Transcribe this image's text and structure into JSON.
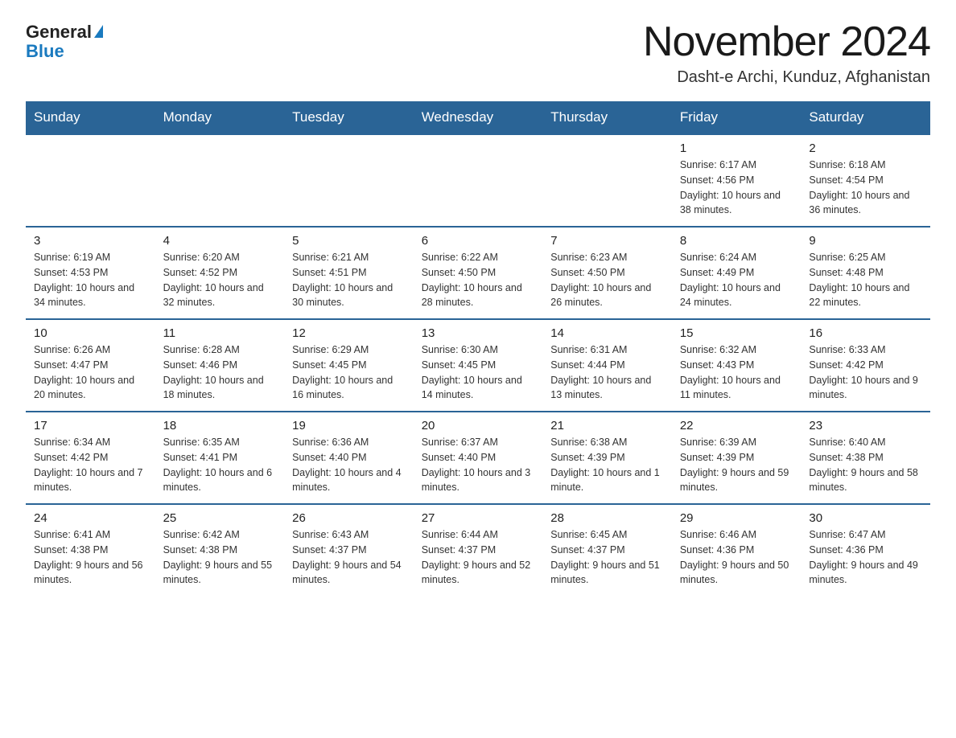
{
  "logo": {
    "general": "General",
    "blue": "Blue",
    "triangle": "▶"
  },
  "title": "November 2024",
  "subtitle": "Dasht-e Archi, Kunduz, Afghanistan",
  "header_color": "#2a6496",
  "weekdays": [
    "Sunday",
    "Monday",
    "Tuesday",
    "Wednesday",
    "Thursday",
    "Friday",
    "Saturday"
  ],
  "weeks": [
    [
      {
        "day": "",
        "info": ""
      },
      {
        "day": "",
        "info": ""
      },
      {
        "day": "",
        "info": ""
      },
      {
        "day": "",
        "info": ""
      },
      {
        "day": "",
        "info": ""
      },
      {
        "day": "1",
        "info": "Sunrise: 6:17 AM\nSunset: 4:56 PM\nDaylight: 10 hours and 38 minutes."
      },
      {
        "day": "2",
        "info": "Sunrise: 6:18 AM\nSunset: 4:54 PM\nDaylight: 10 hours and 36 minutes."
      }
    ],
    [
      {
        "day": "3",
        "info": "Sunrise: 6:19 AM\nSunset: 4:53 PM\nDaylight: 10 hours and 34 minutes."
      },
      {
        "day": "4",
        "info": "Sunrise: 6:20 AM\nSunset: 4:52 PM\nDaylight: 10 hours and 32 minutes."
      },
      {
        "day": "5",
        "info": "Sunrise: 6:21 AM\nSunset: 4:51 PM\nDaylight: 10 hours and 30 minutes."
      },
      {
        "day": "6",
        "info": "Sunrise: 6:22 AM\nSunset: 4:50 PM\nDaylight: 10 hours and 28 minutes."
      },
      {
        "day": "7",
        "info": "Sunrise: 6:23 AM\nSunset: 4:50 PM\nDaylight: 10 hours and 26 minutes."
      },
      {
        "day": "8",
        "info": "Sunrise: 6:24 AM\nSunset: 4:49 PM\nDaylight: 10 hours and 24 minutes."
      },
      {
        "day": "9",
        "info": "Sunrise: 6:25 AM\nSunset: 4:48 PM\nDaylight: 10 hours and 22 minutes."
      }
    ],
    [
      {
        "day": "10",
        "info": "Sunrise: 6:26 AM\nSunset: 4:47 PM\nDaylight: 10 hours and 20 minutes."
      },
      {
        "day": "11",
        "info": "Sunrise: 6:28 AM\nSunset: 4:46 PM\nDaylight: 10 hours and 18 minutes."
      },
      {
        "day": "12",
        "info": "Sunrise: 6:29 AM\nSunset: 4:45 PM\nDaylight: 10 hours and 16 minutes."
      },
      {
        "day": "13",
        "info": "Sunrise: 6:30 AM\nSunset: 4:45 PM\nDaylight: 10 hours and 14 minutes."
      },
      {
        "day": "14",
        "info": "Sunrise: 6:31 AM\nSunset: 4:44 PM\nDaylight: 10 hours and 13 minutes."
      },
      {
        "day": "15",
        "info": "Sunrise: 6:32 AM\nSunset: 4:43 PM\nDaylight: 10 hours and 11 minutes."
      },
      {
        "day": "16",
        "info": "Sunrise: 6:33 AM\nSunset: 4:42 PM\nDaylight: 10 hours and 9 minutes."
      }
    ],
    [
      {
        "day": "17",
        "info": "Sunrise: 6:34 AM\nSunset: 4:42 PM\nDaylight: 10 hours and 7 minutes."
      },
      {
        "day": "18",
        "info": "Sunrise: 6:35 AM\nSunset: 4:41 PM\nDaylight: 10 hours and 6 minutes."
      },
      {
        "day": "19",
        "info": "Sunrise: 6:36 AM\nSunset: 4:40 PM\nDaylight: 10 hours and 4 minutes."
      },
      {
        "day": "20",
        "info": "Sunrise: 6:37 AM\nSunset: 4:40 PM\nDaylight: 10 hours and 3 minutes."
      },
      {
        "day": "21",
        "info": "Sunrise: 6:38 AM\nSunset: 4:39 PM\nDaylight: 10 hours and 1 minute."
      },
      {
        "day": "22",
        "info": "Sunrise: 6:39 AM\nSunset: 4:39 PM\nDaylight: 9 hours and 59 minutes."
      },
      {
        "day": "23",
        "info": "Sunrise: 6:40 AM\nSunset: 4:38 PM\nDaylight: 9 hours and 58 minutes."
      }
    ],
    [
      {
        "day": "24",
        "info": "Sunrise: 6:41 AM\nSunset: 4:38 PM\nDaylight: 9 hours and 56 minutes."
      },
      {
        "day": "25",
        "info": "Sunrise: 6:42 AM\nSunset: 4:38 PM\nDaylight: 9 hours and 55 minutes."
      },
      {
        "day": "26",
        "info": "Sunrise: 6:43 AM\nSunset: 4:37 PM\nDaylight: 9 hours and 54 minutes."
      },
      {
        "day": "27",
        "info": "Sunrise: 6:44 AM\nSunset: 4:37 PM\nDaylight: 9 hours and 52 minutes."
      },
      {
        "day": "28",
        "info": "Sunrise: 6:45 AM\nSunset: 4:37 PM\nDaylight: 9 hours and 51 minutes."
      },
      {
        "day": "29",
        "info": "Sunrise: 6:46 AM\nSunset: 4:36 PM\nDaylight: 9 hours and 50 minutes."
      },
      {
        "day": "30",
        "info": "Sunrise: 6:47 AM\nSunset: 4:36 PM\nDaylight: 9 hours and 49 minutes."
      }
    ]
  ]
}
